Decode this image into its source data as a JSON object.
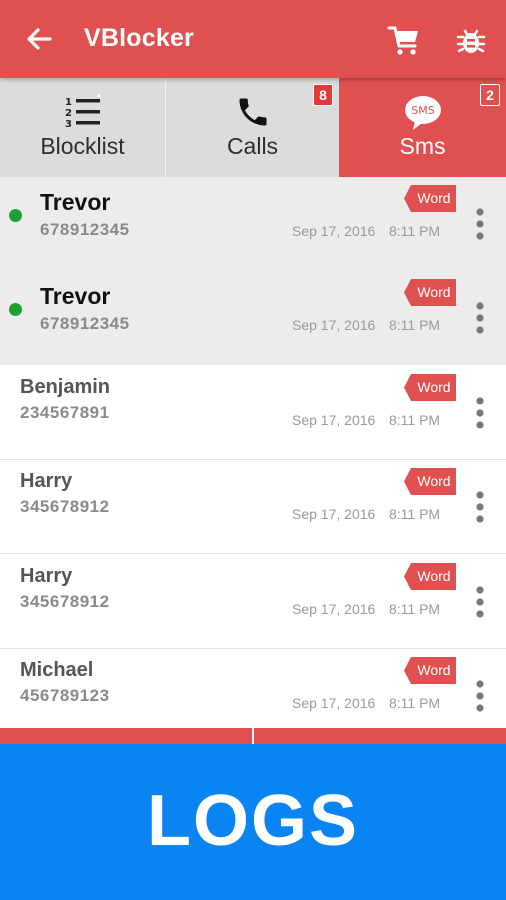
{
  "header": {
    "title": "VBlocker",
    "back_icon": "arrow-left-icon",
    "cart_icon": "cart-icon",
    "bug_icon": "bug-icon",
    "color": "#e05050"
  },
  "tabs": [
    {
      "label": "Blocklist",
      "icon": "numbered-list-icon",
      "badge": "",
      "active": false
    },
    {
      "label": "Calls",
      "icon": "phone-icon",
      "badge": "8",
      "active": false
    },
    {
      "label": "Sms",
      "icon": "sms-bubble-icon",
      "badge": "2",
      "active": true,
      "icon_text": "SMS"
    }
  ],
  "messages": [
    {
      "name": "Trevor",
      "number": "678912345",
      "date": "Sep 17, 2016",
      "time": "8:11 PM",
      "tag": "Word",
      "unread": true
    },
    {
      "name": "Trevor",
      "number": "678912345",
      "date": "Sep 17, 2016",
      "time": "8:11 PM",
      "tag": "Word",
      "unread": true
    },
    {
      "name": "Benjamin",
      "number": "234567891",
      "date": "Sep 17, 2016",
      "time": "8:11 PM",
      "tag": "Word",
      "unread": false
    },
    {
      "name": "Harry",
      "number": "345678912",
      "date": "Sep 17, 2016",
      "time": "8:11 PM",
      "tag": "Word",
      "unread": false
    },
    {
      "name": "Harry",
      "number": "345678912",
      "date": "Sep 17, 2016",
      "time": "8:11 PM",
      "tag": "Word",
      "unread": false
    },
    {
      "name": "Michael",
      "number": "456789123",
      "date": "Sep 17, 2016",
      "time": "8:11 PM",
      "tag": "Word",
      "unread": false
    }
  ],
  "banner": {
    "text": "LOGS",
    "color": "#0a84f2"
  },
  "colors": {
    "accent": "#e05050",
    "unread_dot": "#1fa034",
    "unread_bg": "#ececec"
  }
}
